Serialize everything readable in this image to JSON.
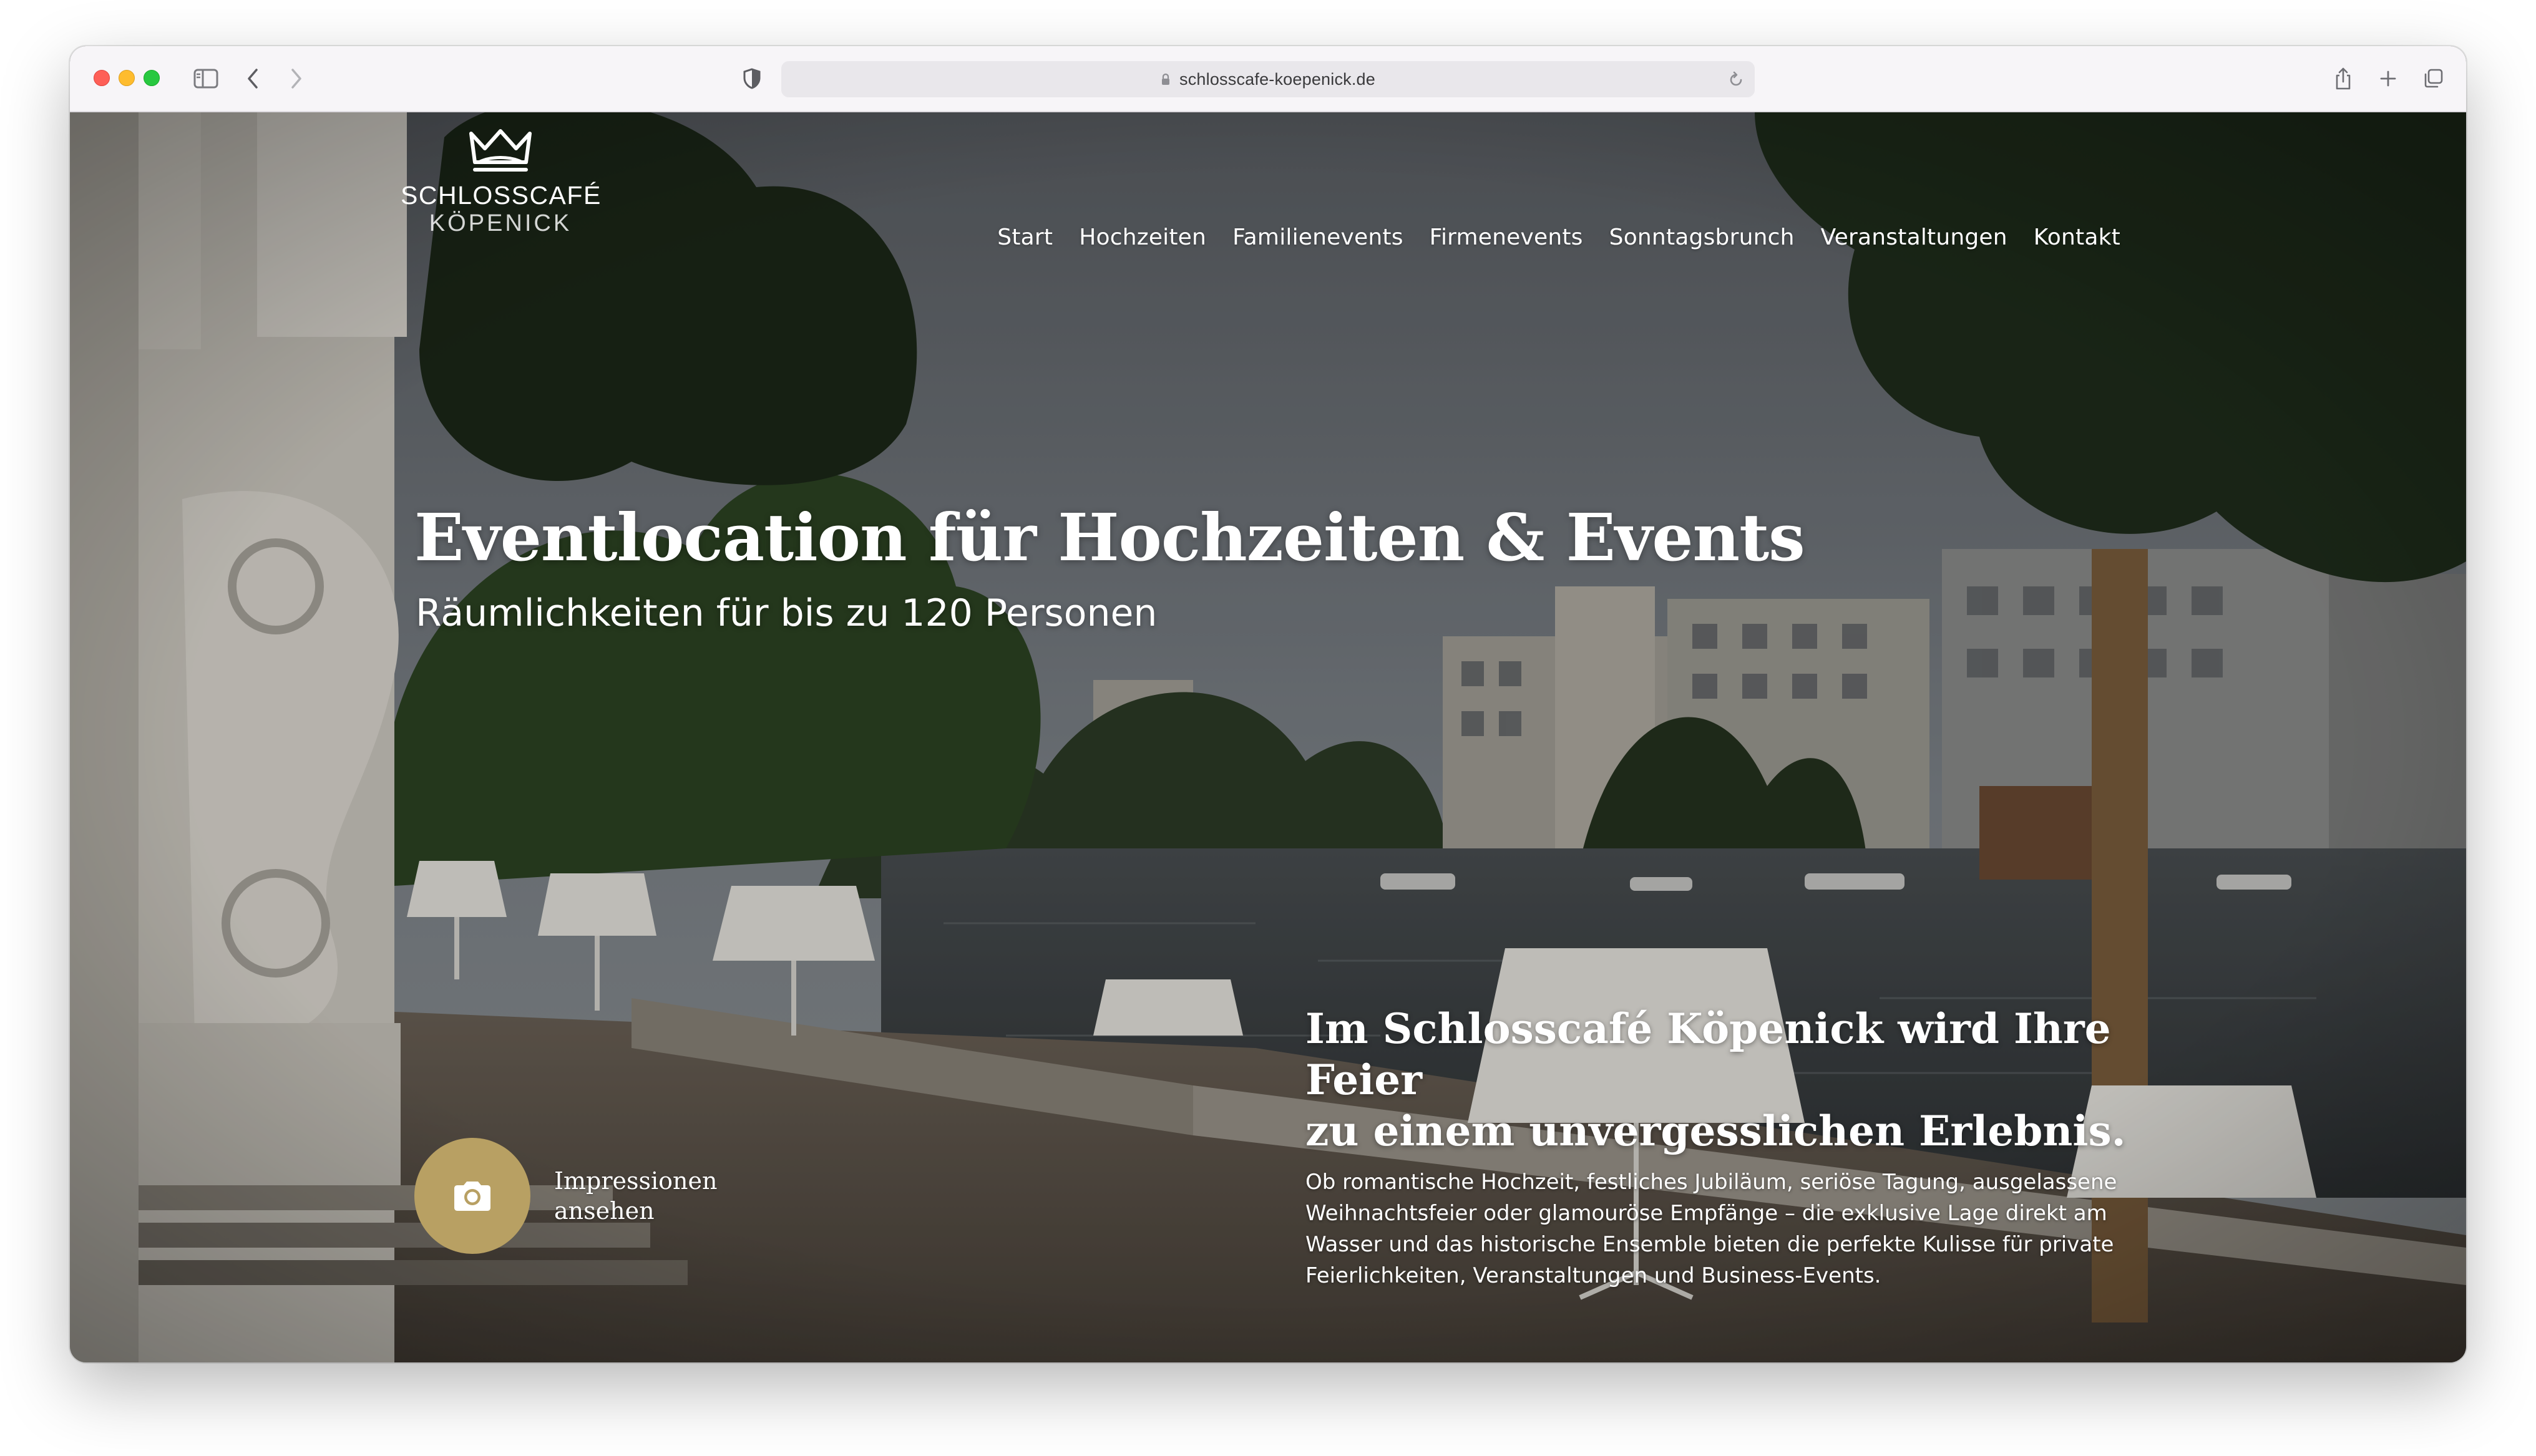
{
  "browser": {
    "url": "schlosscafe-koepenick.de"
  },
  "site": {
    "logo": {
      "line1": "SCHLOSSCAFÉ",
      "line2": "KÖPENICK"
    },
    "nav": [
      {
        "label": "Start"
      },
      {
        "label": "Hochzeiten"
      },
      {
        "label": "Familienevents"
      },
      {
        "label": "Firmenevents"
      },
      {
        "label": "Sonntagsbrunch"
      },
      {
        "label": "Veranstaltungen"
      },
      {
        "label": "Kontakt"
      }
    ],
    "hero": {
      "headline": "Eventlocation für Hochzeiten & Events",
      "subheadline": "Räumlichkeiten für bis zu 120 Personen",
      "impressions_line1": "Impressionen",
      "impressions_line2": "ansehen",
      "intro_heading_line1": "Im Schlosscafé Köpenick wird Ihre Feier",
      "intro_heading_line2": "zu einem unvergesslichen Erlebnis.",
      "intro_text": [
        "Ob romantische Hochzeit, festliches Jubiläum, seriöse Tagung, ausgelassene",
        "Weihnachtsfeier oder glamouröse Empfänge – die exklusive Lage direkt am",
        "Wasser und das historische Ensemble bieten die perfekte Kulisse für private",
        "Feierlichkeiten, Veranstaltungen und Business-Events."
      ]
    },
    "colors": {
      "accent_gold": "#b8a063",
      "text_white": "#ffffff"
    },
    "icons": {
      "camera": "camera-icon",
      "crown": "crown-icon"
    }
  }
}
